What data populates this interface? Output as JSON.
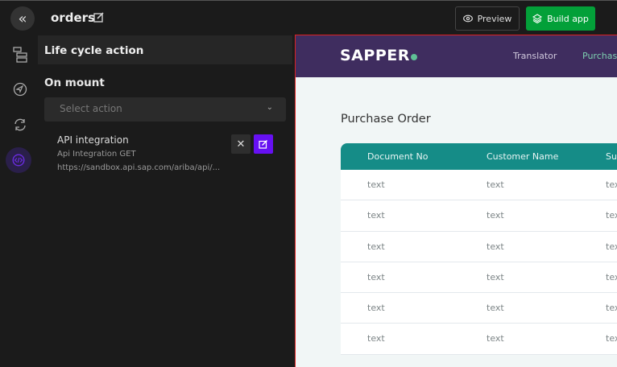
{
  "header": {
    "title": "orders",
    "preview_label": "Preview",
    "build_label": "Build app"
  },
  "panel": {
    "heading": "Life cycle action",
    "section": "On mount",
    "select_placeholder": "Select action",
    "action": {
      "title": "API integration",
      "subtitle": "Api Integration GET",
      "url": "https://sandbox.api.sap.com/ariba/api/..."
    }
  },
  "preview": {
    "logo": "SAPPER",
    "nav": [
      "Translator",
      "Purchase"
    ],
    "page_title": "Purchase Order",
    "columns": [
      "Document No",
      "Customer Name",
      "Sup"
    ],
    "rows": [
      [
        "text",
        "text",
        "text"
      ],
      [
        "text",
        "text",
        "text"
      ],
      [
        "text",
        "text",
        "text"
      ],
      [
        "text",
        "text",
        "text"
      ],
      [
        "text",
        "text",
        "text"
      ],
      [
        "text",
        "text",
        "text"
      ]
    ]
  },
  "colors": {
    "build": "#03a039",
    "accent": "#6610f2",
    "app_header": "#3f2d5f",
    "table_header": "#158c87"
  }
}
